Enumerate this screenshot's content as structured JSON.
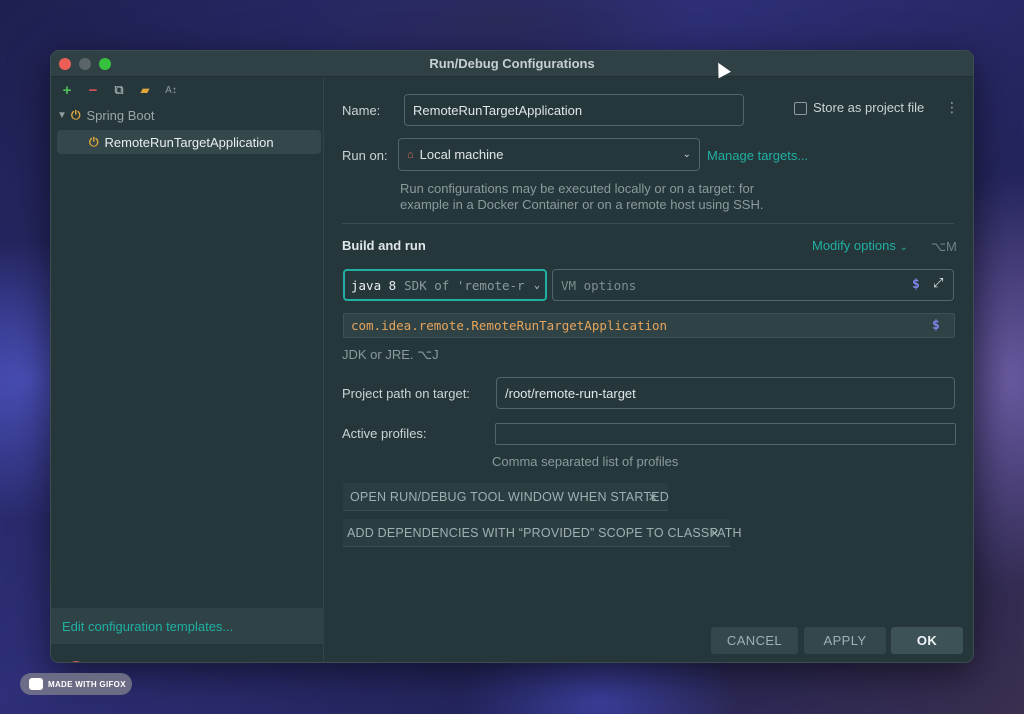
{
  "window": {
    "title": "Run/Debug Configurations"
  },
  "toolbar": {
    "add_glyph": "+",
    "remove_glyph": "−",
    "copy_glyph": "⧉",
    "folder_glyph": "▰",
    "sort_glyph": "A↕"
  },
  "tree": {
    "group_label": "Spring Boot",
    "items": [
      {
        "label": "RemoteRunTargetApplication"
      }
    ]
  },
  "left_footer": {
    "templates_link": "Edit configuration templates..."
  },
  "form": {
    "name_label": "Name:",
    "name_value": "RemoteRunTargetApplication",
    "store_label": "Store as project file",
    "run_on_label": "Run on:",
    "run_on_value": "Local machine",
    "manage_targets": "Manage targets...",
    "run_on_hint_line1": "Run configurations may be executed locally or on a target: for",
    "run_on_hint_line2": "example in a Docker Container or on a remote host using SSH.",
    "build_run_title": "Build and run",
    "modify_options": "Modify options",
    "modify_shortcut": "⌥M",
    "jdk_version": "java 8",
    "jdk_detail": "SDK of 'remote-r",
    "vm_placeholder": "VM options",
    "main_class": "com.idea.remote.RemoteRunTargetApplication",
    "jdk_hint": "JDK or JRE. ⌥J",
    "project_path_label": "Project path on target:",
    "project_path_value": "/root/remote-run-target",
    "active_profiles_label": "Active profiles:",
    "active_profiles_value": "",
    "profiles_hint": "Comma separated list of profiles",
    "option_rows": [
      {
        "label": "OPEN RUN/DEBUG TOOL WINDOW WHEN STARTED"
      },
      {
        "label": "ADD DEPENDENCIES WITH “PROVIDED” SCOPE TO CLASSPATH"
      }
    ]
  },
  "buttons": {
    "cancel": "CANCEL",
    "apply": "APPLY",
    "ok": "OK"
  },
  "watermark": {
    "text": "MADE WITH GIFOX"
  },
  "colors": {
    "accent": "#1fb0a3",
    "dialog_bg": "#26373b",
    "main_class_text": "#e8a55a",
    "macro_dollar": "#7f84e6"
  }
}
